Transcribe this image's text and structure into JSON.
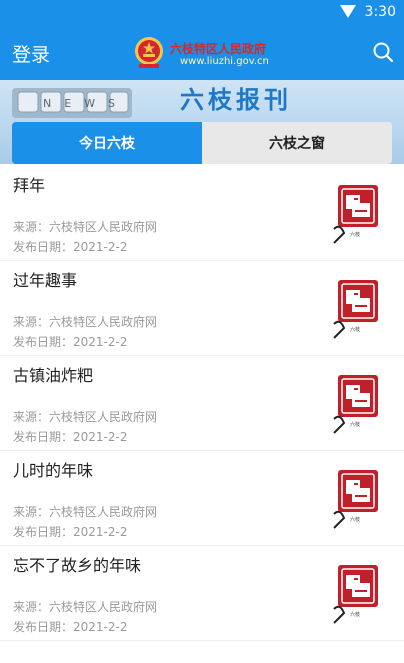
{
  "status_bar": {
    "time": "3:30"
  },
  "header": {
    "login_label": "登录",
    "brand_name": "六枝特区人民政府",
    "brand_url": "www.liuzhi.gov.cn"
  },
  "banner": {
    "keyboard_text": "NEWS",
    "title": "六枝报刊"
  },
  "tabs": [
    {
      "label": "今日六枝",
      "active": true
    },
    {
      "label": "六枝之窗",
      "active": false
    }
  ],
  "news": [
    {
      "title": "拜年",
      "source": "来源：六枝特区人民政府网",
      "date": "发布日期：2021-2-2"
    },
    {
      "title": "过年趣事",
      "source": "来源：六枝特区人民政府网",
      "date": "发布日期：2021-2-2"
    },
    {
      "title": "古镇油炸粑",
      "source": "来源：六枝特区人民政府网",
      "date": "发布日期：2021-2-2"
    },
    {
      "title": "儿时的年味",
      "source": "来源：六枝特区人民政府网",
      "date": "发布日期：2021-2-2"
    },
    {
      "title": "忘不了故乡的年味",
      "source": "来源：六枝特区人民政府网",
      "date": "发布日期：2021-2-2"
    }
  ],
  "thumbnail": {
    "seal_text": "六枝"
  },
  "colors": {
    "primary": "#1a90e8",
    "seal_red": "#c0202a",
    "meta_gray": "#9a9a9a"
  }
}
